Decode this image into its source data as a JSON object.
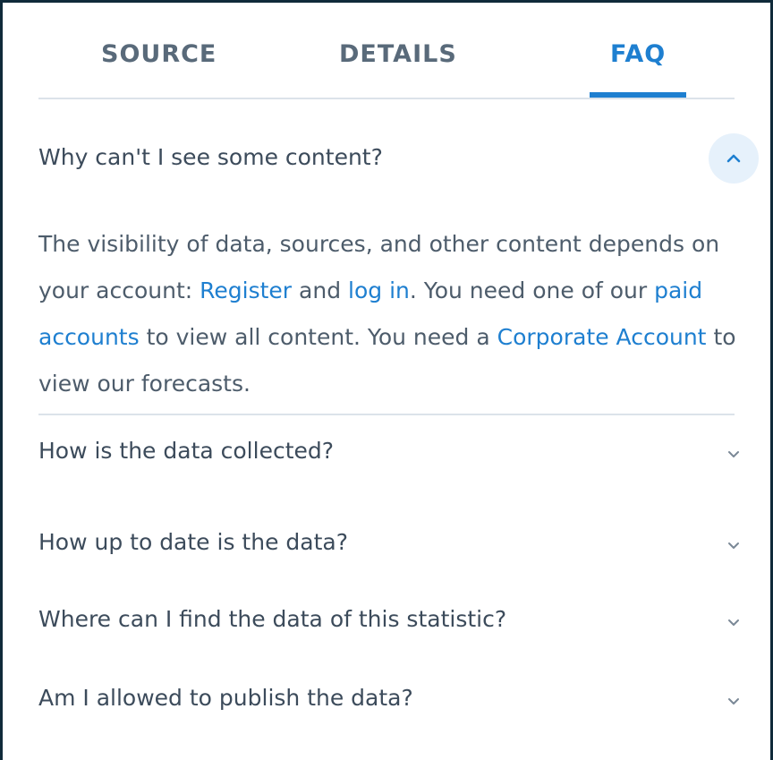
{
  "tabs": [
    {
      "label": "SOURCE",
      "active": false
    },
    {
      "label": "DETAILS",
      "active": false
    },
    {
      "label": "FAQ",
      "active": true
    }
  ],
  "faq": {
    "expanded": {
      "question": "Why can't I see some content?",
      "toggle_icon": "chevron-up-icon",
      "answer": {
        "t1": "The visibility of data, sources, and other content depends on your account: ",
        "link_register": "Register",
        "t2": " and ",
        "link_login": "log in",
        "t3": ". You need one of our ",
        "link_paid": "paid accounts",
        "t4": " to view all content. You need a ",
        "link_corporate": "Corporate Account",
        "t5": " to view our forecasts."
      }
    },
    "items": [
      {
        "question": "How is the data collected?",
        "toggle_icon": "chevron-down-icon"
      },
      {
        "question": "How up to date is the data?",
        "toggle_icon": "chevron-down-icon"
      },
      {
        "question": "Where can I find the data of this statistic?",
        "toggle_icon": "chevron-down-icon"
      },
      {
        "question": "Am I allowed to publish the data?",
        "toggle_icon": "chevron-down-icon"
      }
    ]
  },
  "colors": {
    "accent": "#1e7fd0",
    "tab_inactive": "#596a7a",
    "text": "#3c4b5b",
    "divider": "#dce3ea",
    "frame_border": "#0f2a3a",
    "toggle_bg": "#e6f1fb"
  }
}
